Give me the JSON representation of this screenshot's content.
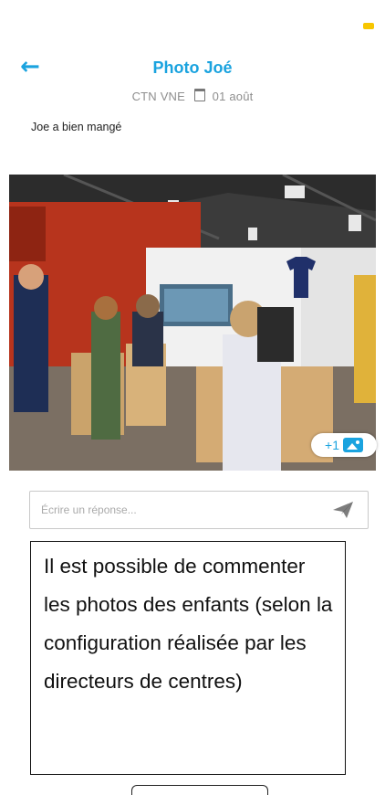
{
  "header": {
    "back_icon": "arrow-left-icon",
    "title": "Photo Joé"
  },
  "meta": {
    "author": "CTN VNE",
    "calendar_icon": "calendar-icon",
    "date": "01 août"
  },
  "post": {
    "caption": "Joe a bien mangé",
    "extra_photos_badge": "+1",
    "extra_photos_icon": "image-icon"
  },
  "reply": {
    "placeholder": "Écrire un réponse...",
    "send_icon": "send-icon"
  },
  "note": {
    "text": "Il est possible de commenter les photos des enfants (selon la configuration réalisée par les directeurs de centres)"
  },
  "colors": {
    "accent": "#1aa3df",
    "status_dot": "#f7c600"
  }
}
